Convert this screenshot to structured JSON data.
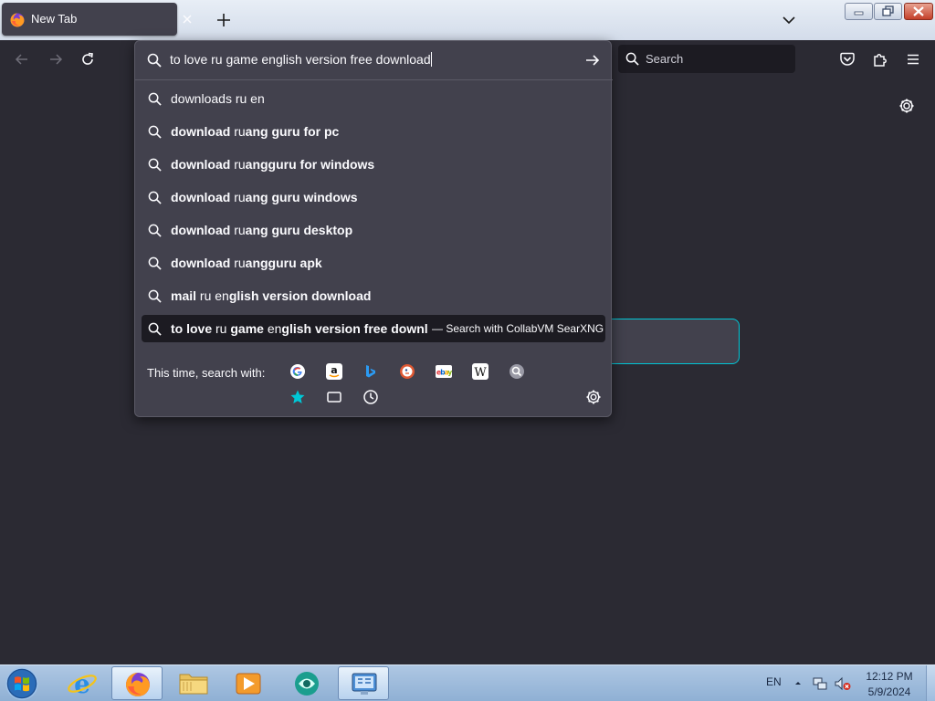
{
  "tabs": [
    {
      "title": "New Tab"
    }
  ],
  "toolbar": {
    "search_placeholder": "Search"
  },
  "urlbar": {
    "value": "to love ru game english version free download",
    "suggestions": [
      {
        "bold_prefix": "",
        "normal": "downloads ru en",
        "bold_rest": ""
      },
      {
        "bold_prefix": "download",
        "normal": " ru",
        "bold_rest": "ang guru for pc"
      },
      {
        "bold_prefix": "download",
        "normal": " ru",
        "bold_rest": "angguru for windows"
      },
      {
        "bold_prefix": "download",
        "normal": " ru",
        "bold_rest": "ang guru windows"
      },
      {
        "bold_prefix": "download",
        "normal": " ru",
        "bold_rest": "ang guru desktop"
      },
      {
        "bold_prefix": "download",
        "normal": " ru",
        "bold_rest": "angguru apk"
      },
      {
        "bold_prefix": "mail",
        "normal": " ru en",
        "bold_rest": "glish version download"
      }
    ],
    "selected": {
      "p1": "to love",
      "p2": " ru ",
      "p3": "game",
      "p4": " en",
      "p5": "glish version free download",
      "hint": "— Search with CollabVM SearXNG"
    },
    "oneoff_label": "This time, search with:",
    "engines": [
      "Google",
      "Amazon",
      "Bing",
      "DuckDuckGo",
      "eBay",
      "Wikipedia",
      "CollabVM SearXNG"
    ]
  },
  "taskbar": {
    "language": "EN",
    "time": "12:12 PM",
    "date": "5/9/2024"
  },
  "colors": {
    "accent": "#00c7d6",
    "popup_bg": "#42414d",
    "selected_bg": "#1c1b22",
    "toolbar_bg": "#2b2a33"
  }
}
